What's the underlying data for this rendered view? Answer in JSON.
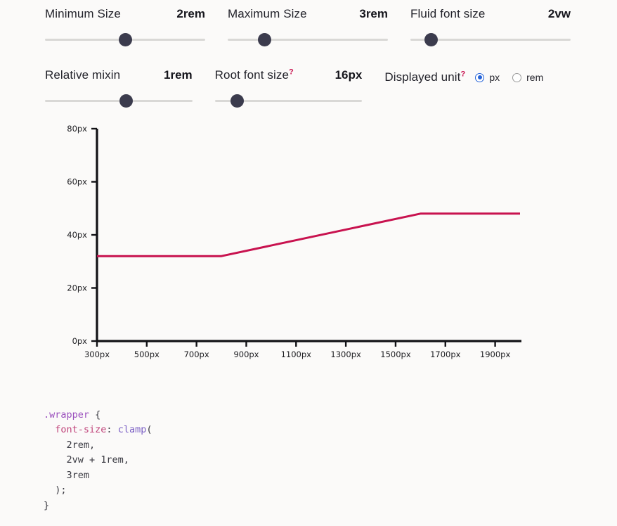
{
  "controls": {
    "row1": [
      {
        "name": "minimum-size",
        "label": "Minimum Size",
        "value": "2rem",
        "thumb_pct": 50,
        "help": false
      },
      {
        "name": "maximum-size",
        "label": "Maximum Size",
        "value": "3rem",
        "thumb_pct": 23,
        "help": false
      },
      {
        "name": "fluid-font-size",
        "label": "Fluid font size",
        "value": "2vw",
        "thumb_pct": 13,
        "help": false
      }
    ],
    "row2": [
      {
        "name": "relative-mixin",
        "label": "Relative mixin",
        "value": "1rem",
        "thumb_pct": 55,
        "help": false
      },
      {
        "name": "root-font-size",
        "label": "Root font size",
        "value": "16px",
        "thumb_pct": 15,
        "help": true
      }
    ],
    "help_mark": "?",
    "displayed_unit": {
      "label": "Displayed unit",
      "help": "?",
      "options": [
        {
          "label": "px",
          "selected": true
        },
        {
          "label": "rem",
          "selected": false
        }
      ]
    }
  },
  "chart_data": {
    "type": "line",
    "title": "",
    "xlabel": "",
    "ylabel": "",
    "xlim": [
      300,
      2000
    ],
    "ylim": [
      0,
      80
    ],
    "xticks": [
      300,
      500,
      700,
      900,
      1100,
      1300,
      1500,
      1700,
      1900
    ],
    "xtick_labels": [
      "300px",
      "500px",
      "700px",
      "900px",
      "1100px",
      "1300px",
      "1500px",
      "1700px",
      "1900px"
    ],
    "yticks": [
      0,
      20,
      40,
      60,
      80
    ],
    "ytick_labels": [
      "0px",
      "20px",
      "40px",
      "60px",
      "80px"
    ],
    "grid": false,
    "legend": false,
    "line_color": "#c8124f",
    "axis_color": "#121216",
    "series": [
      {
        "name": "clamp(2rem, 2vw + 1rem, 3rem)",
        "x": [
          300,
          800,
          1600,
          2000
        ],
        "y": [
          32,
          32,
          48,
          48
        ]
      }
    ]
  },
  "code": {
    "lines": [
      [
        {
          "t": ".wrapper",
          "c": "sel"
        },
        {
          "t": " {",
          "c": "pun"
        }
      ],
      [
        {
          "t": "  ",
          "c": "pun"
        },
        {
          "t": "font-size",
          "c": "prop"
        },
        {
          "t": ": ",
          "c": "pun"
        },
        {
          "t": "clamp",
          "c": "fn"
        },
        {
          "t": "(",
          "c": "pun"
        }
      ],
      [
        {
          "t": "    2rem,",
          "c": "val"
        }
      ],
      [
        {
          "t": "    2vw + 1rem,",
          "c": "val"
        }
      ],
      [
        {
          "t": "    3rem",
          "c": "val"
        }
      ],
      [
        {
          "t": "  );",
          "c": "pun"
        }
      ],
      [
        {
          "t": "}",
          "c": "pun"
        }
      ]
    ]
  },
  "colors": {
    "background": "#fbfaf9",
    "accent_line": "#c8124f",
    "thumb": "#3b3b4d",
    "track": "#d9d8d6",
    "radio_accent": "#2563d8",
    "help_mark": "#c8124f"
  }
}
